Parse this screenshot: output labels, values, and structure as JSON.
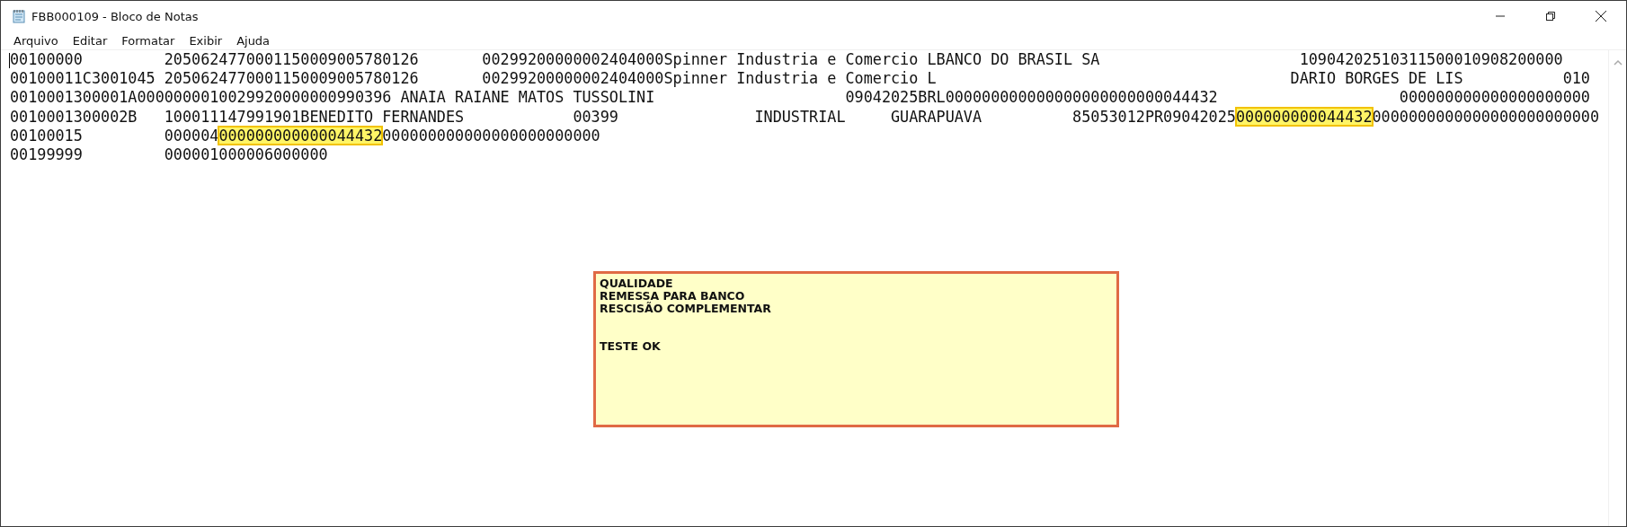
{
  "window": {
    "title": "FBB000109 - Bloco de Notas"
  },
  "menu": [
    {
      "label": "Arquivo"
    },
    {
      "label": "Editar"
    },
    {
      "label": "Formatar"
    },
    {
      "label": "Exibir"
    },
    {
      "label": "Ajuda"
    }
  ],
  "document": {
    "lines": [
      [
        {
          "text": "00100000         2050624770001150009005780126       00299200000002404000Spinner Industria e Comercio LBANCO DO BRASIL SA                      10904202510311500010908200000",
          "highlighted": false
        }
      ],
      [
        {
          "text": "00100011C3001045 2050624770001150009005780126       00299200000002404000Spinner Industria e Comercio L                                       DARIO BORGES DE LIS           010",
          "highlighted": false
        }
      ],
      [
        {
          "text": "0010001300001A0000000010029920000000990396 ANAIA RAIANE MATOS TUSSOLINI                     09042025BRL000000000000000000000000044432                    000000000000000000000",
          "highlighted": false
        }
      ],
      [
        {
          "text": "0010001300002B   100011147991901BENEDITO FERNANDES            00399               INDUSTRIAL     GUARAPUAVA          85053012PR09042025",
          "highlighted": false
        },
        {
          "text": "000000000044432",
          "highlighted": true
        },
        {
          "text": "0000000000000000000000000",
          "highlighted": false
        }
      ],
      [
        {
          "text": "00100015         000004",
          "highlighted": false
        },
        {
          "text": "000000000000044432",
          "highlighted": true
        },
        {
          "text": "000000000000000000000000",
          "highlighted": false
        }
      ],
      [
        {
          "text": "00199999         000001000006000000",
          "highlighted": false
        }
      ]
    ]
  },
  "note": {
    "paragraphs": [
      [
        "QUALIDADE",
        "REMESSA PARA BANCO",
        "RESCISÃO COMPLEMENTAR"
      ],
      [
        "TESTE OK"
      ]
    ]
  }
}
